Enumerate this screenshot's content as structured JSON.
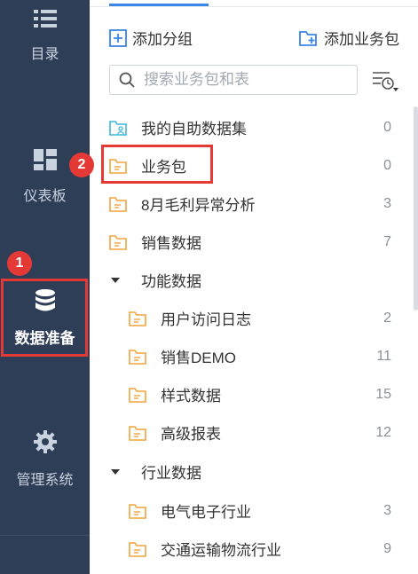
{
  "nav": {
    "items": [
      {
        "label": "目录",
        "icon": "list-icon"
      },
      {
        "label": "仪表板",
        "icon": "dashboard-icon"
      },
      {
        "label": "数据准备",
        "icon": "database-icon",
        "active": true
      },
      {
        "label": "管理系统",
        "icon": "gear-icon"
      }
    ]
  },
  "annotations": {
    "marker1": "1",
    "marker2": "2",
    "color": "#e53935"
  },
  "toolbar": {
    "add_group": "添加分组",
    "add_package": "添加业务包"
  },
  "search": {
    "placeholder": "搜索业务包和表"
  },
  "tree": {
    "items": [
      {
        "name": "我的自助数据集",
        "count": "0",
        "type": "self-service-folder"
      },
      {
        "name": "业务包",
        "count": "0",
        "type": "folder"
      },
      {
        "name": "8月毛利异常分析",
        "count": "3",
        "type": "folder"
      },
      {
        "name": "销售数据",
        "count": "7",
        "type": "folder"
      }
    ],
    "groups": [
      {
        "name": "功能数据",
        "items": [
          {
            "name": "用户访问日志",
            "count": "2"
          },
          {
            "name": "销售DEMO",
            "count": "11"
          },
          {
            "name": "样式数据",
            "count": "15"
          },
          {
            "name": "高级报表",
            "count": "12"
          }
        ]
      },
      {
        "name": "行业数据",
        "items": [
          {
            "name": "电气电子行业",
            "count": "3"
          },
          {
            "name": "交通运输物流行业",
            "count": "9"
          }
        ]
      }
    ]
  },
  "colors": {
    "nav_bg": "#2e3e57",
    "accent": "#3b86e6",
    "folder": "#f2a33a",
    "self_folder": "#3ab7d9"
  }
}
